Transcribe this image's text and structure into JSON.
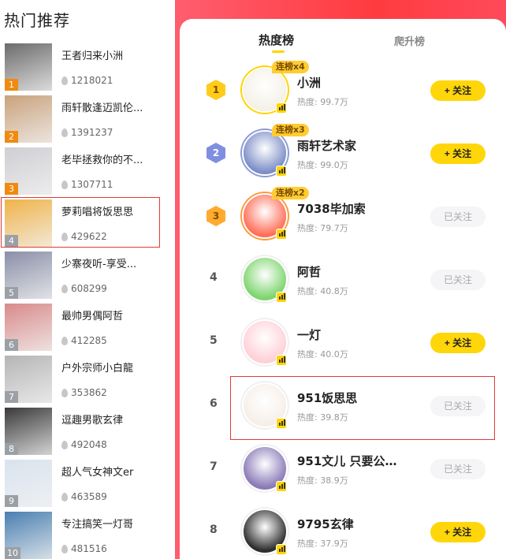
{
  "left": {
    "title": "热门推荐",
    "items": [
      {
        "rank": "1",
        "name": "王者归来小洲",
        "count": "1218021",
        "thumb_color": "#6b6b6b"
      },
      {
        "rank": "2",
        "name": "雨轩散逢迈凯伦...",
        "count": "1391237",
        "thumb_color": "#c9a27c"
      },
      {
        "rank": "3",
        "name": "老毕拯救你的不...",
        "count": "1307711",
        "thumb_color": "#cfcfd4"
      },
      {
        "rank": "4",
        "name": "萝莉唱将饭思思",
        "count": "429622",
        "thumb_color": "#f0b34a"
      },
      {
        "rank": "5",
        "name": "少寨夜听-享受...",
        "count": "608299",
        "thumb_color": "#8a8fa8"
      },
      {
        "rank": "6",
        "name": "最帅男偶阿哲",
        "count": "412285",
        "thumb_color": "#d98a8a"
      },
      {
        "rank": "7",
        "name": "户外宗师小白龍",
        "count": "353862",
        "thumb_color": "#b5b5b5"
      },
      {
        "rank": "8",
        "name": "逗趣男歌玄律",
        "count": "492048",
        "thumb_color": "#3a3a3a"
      },
      {
        "rank": "9",
        "name": "超人气女神文er",
        "count": "463589",
        "thumb_color": "#d9e3ee"
      },
      {
        "rank": "10",
        "name": "专注搞笑一灯哥",
        "count": "481516",
        "thumb_color": "#4a7fb0"
      }
    ]
  },
  "right": {
    "tabs": {
      "hot": "热度榜",
      "rise": "爬升榜"
    },
    "items": [
      {
        "rank": "1",
        "name": "小洲",
        "heat": "热度: 99.7万",
        "streak": "连榜x4",
        "button": "+ 关注",
        "followed": false,
        "avatar_color": "#f4f1e8",
        "ring_color": "#ffd400"
      },
      {
        "rank": "2",
        "name": "雨轩艺术家",
        "heat": "热度: 99.0万",
        "streak": "连榜x3",
        "button": "+ 关注",
        "followed": false,
        "avatar_color": "#7d8fc7",
        "ring_color": "#8d9bd6"
      },
      {
        "rank": "3",
        "name": "7038毕加索",
        "heat": "热度: 79.7万",
        "streak": "连榜x2",
        "button": "已关注",
        "followed": true,
        "avatar_color": "#ff6f5a",
        "ring_color": "#ff9a3d"
      },
      {
        "rank": "4",
        "name": "阿哲",
        "heat": "热度: 40.8万",
        "streak": "",
        "button": "已关注",
        "followed": true,
        "avatar_color": "#7ed56f",
        "ring_color": "#f0f0f0"
      },
      {
        "rank": "5",
        "name": "一灯",
        "heat": "热度: 40.0万",
        "streak": "",
        "button": "+ 关注",
        "followed": false,
        "avatar_color": "#ffd0d8",
        "ring_color": "#f0f0f0"
      },
      {
        "rank": "6",
        "name": "951饭思思",
        "heat": "热度: 39.8万",
        "streak": "",
        "button": "已关注",
        "followed": true,
        "avatar_color": "#f6efe8",
        "ring_color": "#f0f0f0"
      },
      {
        "rank": "7",
        "name": "951文儿 只要公…",
        "heat": "热度: 38.9万",
        "streak": "",
        "button": "已关注",
        "followed": true,
        "avatar_color": "#8a7ab8",
        "ring_color": "#f0f0f0"
      },
      {
        "rank": "8",
        "name": "9795玄律",
        "heat": "热度: 37.9万",
        "streak": "",
        "button": "+ 关注",
        "followed": false,
        "avatar_color": "#2e2e2e",
        "ring_color": "#f0f0f0"
      }
    ],
    "badge_colors": {
      "1": "#ffcc1a",
      "2": "#7f8fe0",
      "3": "#ffab2e"
    }
  }
}
